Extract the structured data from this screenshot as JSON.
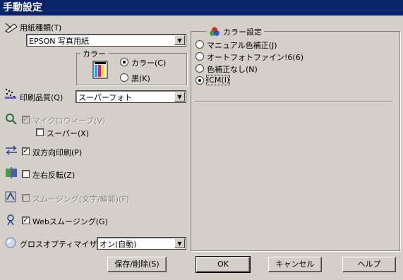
{
  "window": {
    "title": "手動設定"
  },
  "paper": {
    "label": "用紙種類(T)",
    "value": "EPSON 写真用紙"
  },
  "color_group": {
    "title": "カラー",
    "options": [
      {
        "label": "カラー(C)",
        "selected": true
      },
      {
        "label": "黒(K)",
        "selected": false
      }
    ]
  },
  "quality": {
    "label": "印刷品質(Q)",
    "value": "スーパーフォト"
  },
  "microweave": {
    "label": "マイクロウィーブ(V)",
    "checked": true,
    "enabled": false
  },
  "super": {
    "label": "スーパー(X)",
    "checked": false,
    "enabled": true
  },
  "bidirectional": {
    "label": "双方向印刷(P)",
    "checked": true
  },
  "mirror": {
    "label": "左右反転(Z)",
    "checked": false
  },
  "smoothing": {
    "label": "スムージング(文字/輪郭)(F)",
    "checked": false,
    "enabled": false
  },
  "web_smoothing": {
    "label": "Webスムージング(G)",
    "checked": true
  },
  "gloss": {
    "label": "グロスオプティマイザ(H)",
    "value": "オン(自動)"
  },
  "color_settings": {
    "title": "カラー設定",
    "options": [
      {
        "label": "マニュアル色補正(J)",
        "selected": false
      },
      {
        "label": "オートフォトファイン!6(6)",
        "selected": false
      },
      {
        "label": "色補正なし(N)",
        "selected": false
      },
      {
        "label": "ICM(I)",
        "selected": true
      }
    ]
  },
  "buttons": {
    "save_delete": "保存/削除(S)",
    "ok": "OK",
    "cancel": "キャンセル",
    "help": "ヘルプ"
  },
  "check_mark": "✓"
}
